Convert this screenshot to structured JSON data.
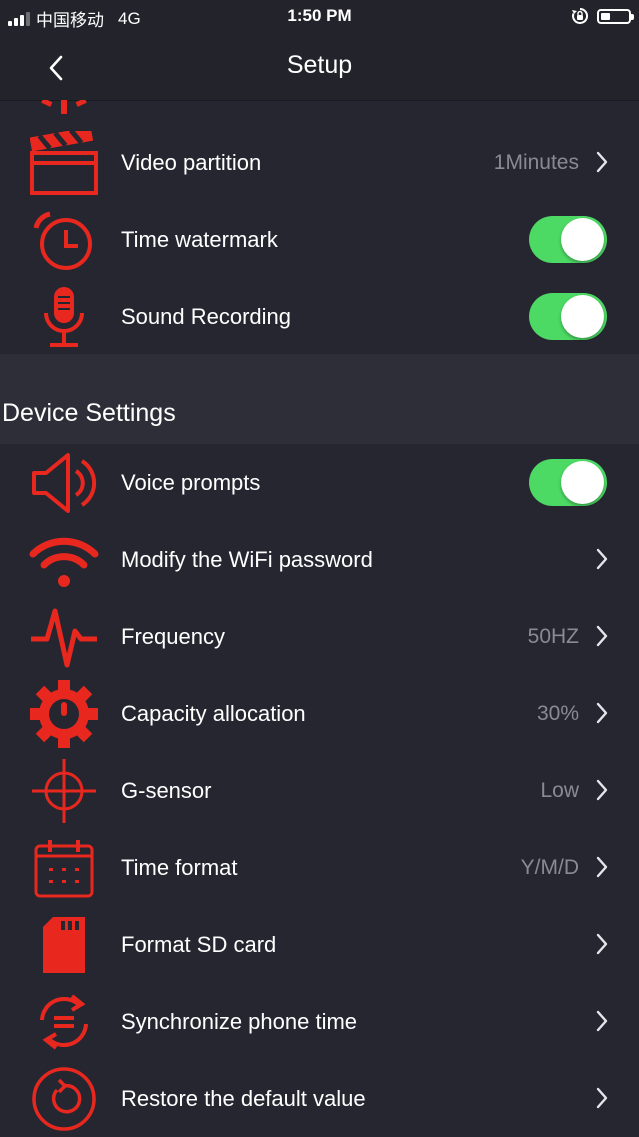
{
  "status_bar": {
    "carrier": "中国移动",
    "network": "4G",
    "time": "1:50 PM",
    "battery_level": 0.35
  },
  "nav": {
    "title": "Setup"
  },
  "top_rows": [
    {
      "label": "Video partition",
      "value": "1Minutes",
      "icon": "clapperboard-icon"
    },
    {
      "label": "Time watermark",
      "toggle": true,
      "icon": "alarm-clock-icon"
    },
    {
      "label": "Sound Recording",
      "toggle": true,
      "icon": "microphone-icon"
    }
  ],
  "section": {
    "title": "Device Settings"
  },
  "device_rows": [
    {
      "label": "Voice prompts",
      "toggle": true,
      "icon": "speaker-icon"
    },
    {
      "label": "Modify the WiFi password",
      "value": "",
      "icon": "wifi-icon"
    },
    {
      "label": "Frequency",
      "value": "50HZ",
      "icon": "pulse-icon"
    },
    {
      "label": "Capacity allocation",
      "value": "30%",
      "icon": "gauge-gear-icon"
    },
    {
      "label": "G-sensor",
      "value": "Low",
      "icon": "crosshair-icon"
    },
    {
      "label": "Time format",
      "value": "Y/M/D",
      "icon": "calendar-icon"
    },
    {
      "label": "Format SD card",
      "value": "",
      "icon": "sd-card-icon"
    },
    {
      "label": "Synchronize phone time",
      "value": "",
      "icon": "sync-icon"
    },
    {
      "label": "Restore the default value",
      "value": "",
      "icon": "restore-icon"
    }
  ],
  "colors": {
    "accent": "#e8281f",
    "toggle_on": "#4cd964",
    "background": "#262631",
    "value_text": "#8a8a92"
  }
}
